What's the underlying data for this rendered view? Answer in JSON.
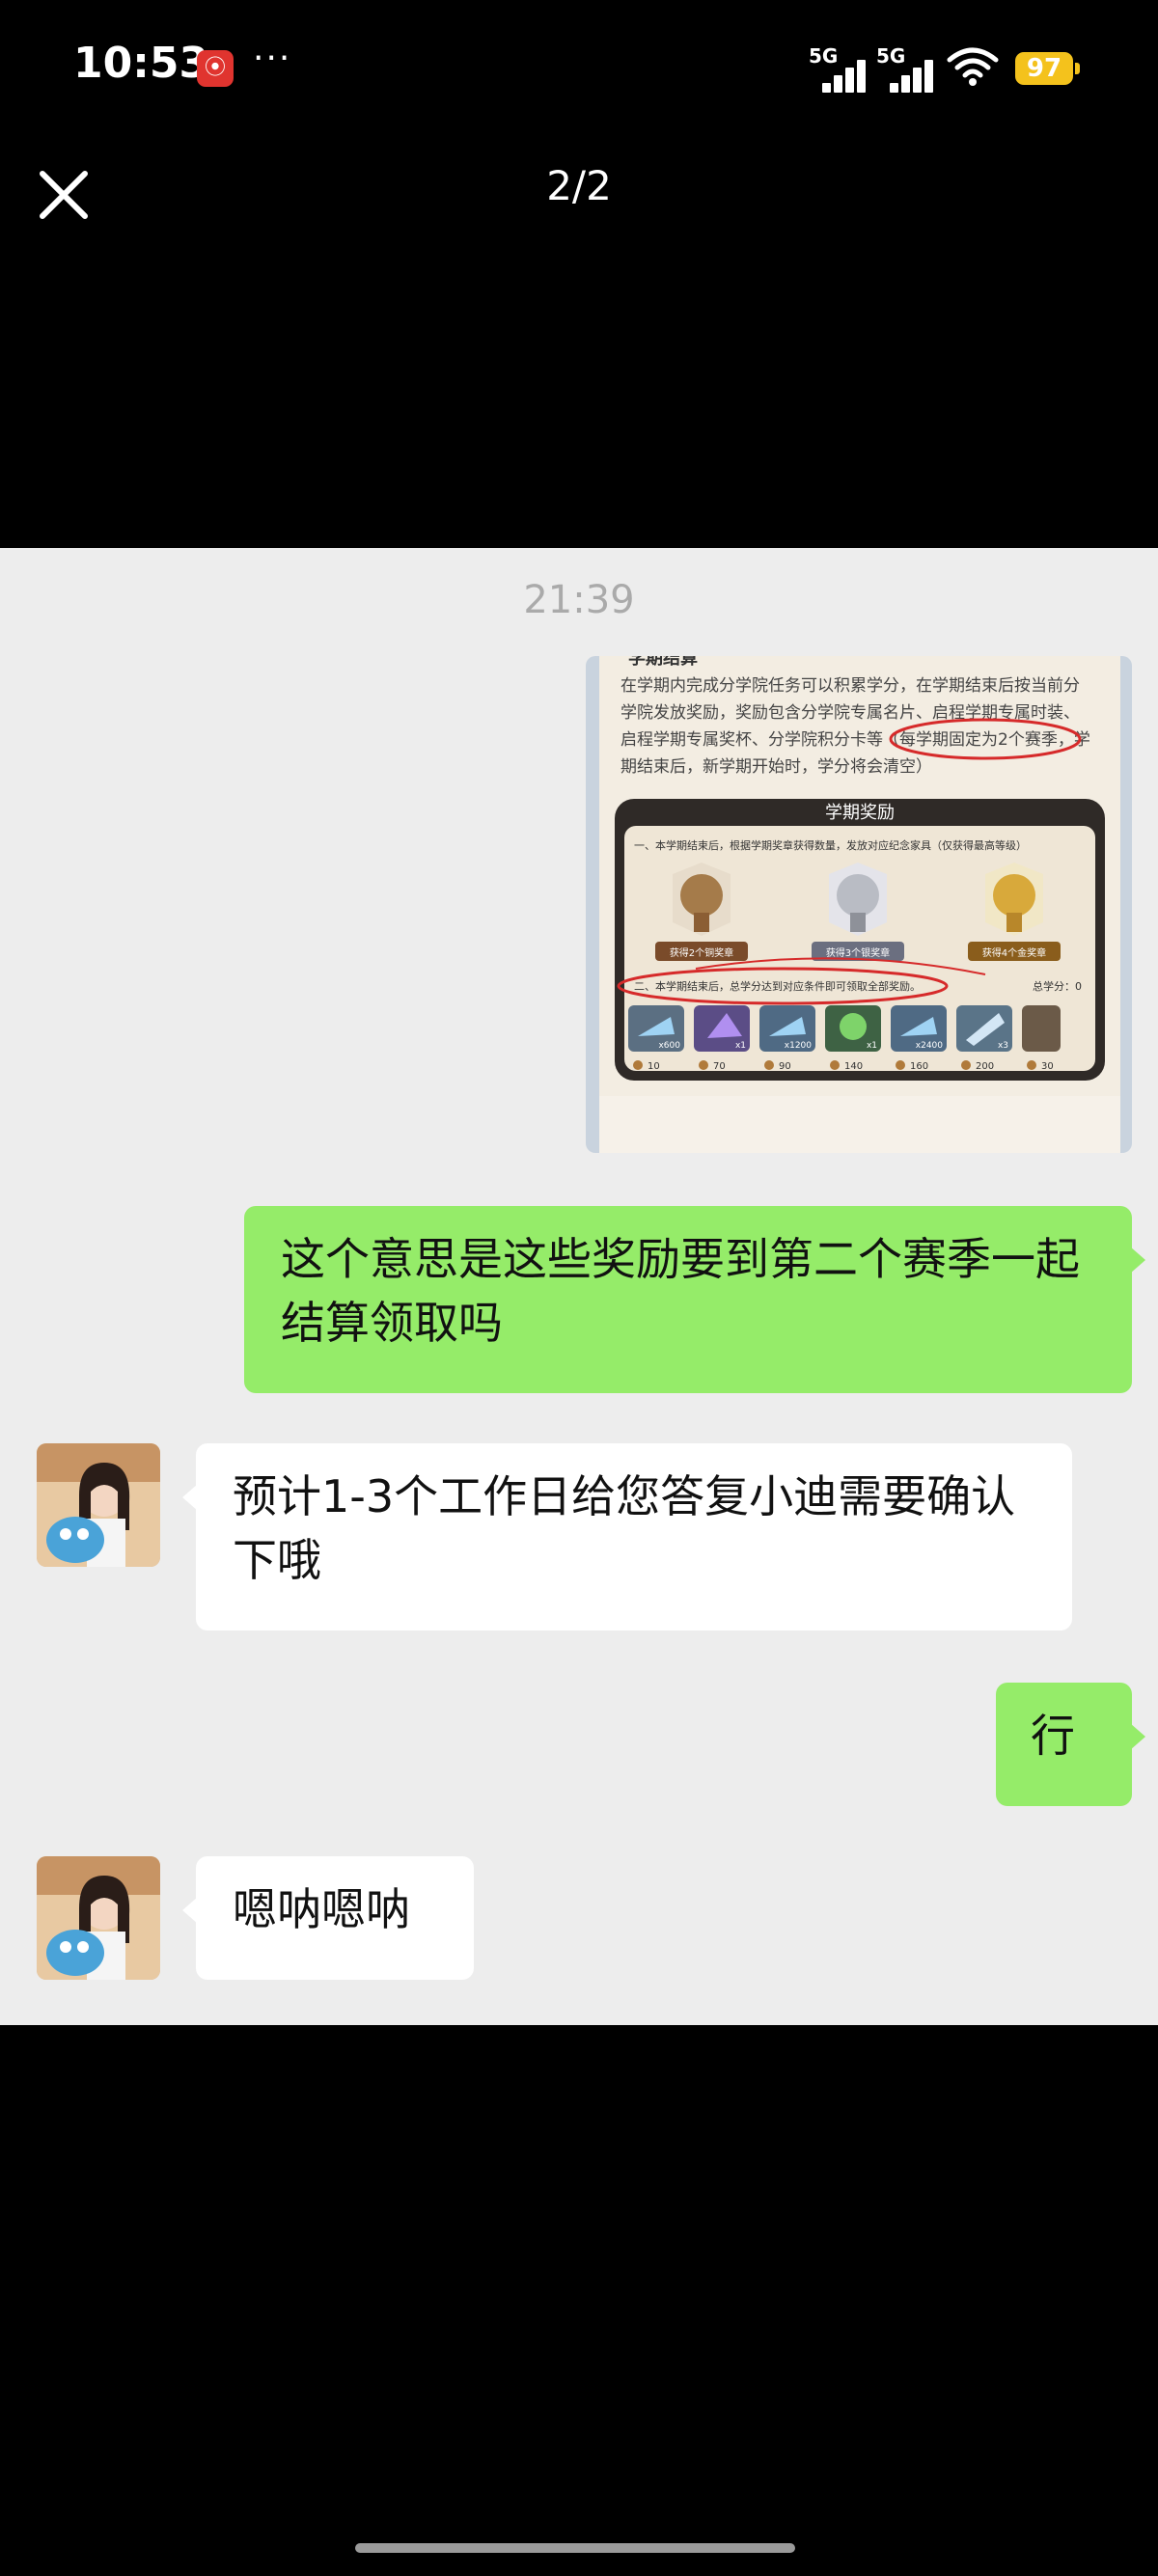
{
  "status_bar": {
    "time": "10:53",
    "notification_badge": "⦿",
    "more": "···",
    "sim1_label": "5G",
    "sim2_label": "5G",
    "battery": "97",
    "battery_color": "#f4c21c"
  },
  "viewer": {
    "page_indicator": "2/2"
  },
  "chat": {
    "timestamp": "21:39",
    "screenshot": {
      "header": "学期结算",
      "body_text": "在学期内完成分学院任务可以积累学分，在学期结束后按当前分学院发放奖励，奖励包含分学院专属名片、启程学期专属时装、启程学期专属奖杯、分学院积分卡等（每学期固定为2个赛季，学期结束后，新学期开始时，学分将会清空）",
      "body_lines": [
        "在学期内完成分学院任务可以积累学分，在学期结束后按当前分",
        "学院发放奖励，奖励包含分学院专属名片、启程学期专属时装、",
        "启程学期专属奖杯、分学院积分卡等（每学期固定为2个赛季，学",
        "期结束后，新学期开始时，学分将会清空）"
      ],
      "highlight": "每学期固定为2个赛季",
      "panel_title": "学期奖励",
      "panel_note1": "一、本学期结束后，根据学期奖章获得数量，发放对应纪念家具（仅获得最高等级）",
      "trophies": [
        "获得2个铜奖章",
        "获得3个银奖章",
        "获得4个金奖章"
      ],
      "panel_note2": "二、本学期结束后，总学分达到对应条件即可领取全部奖励。",
      "total_credits": "总学分：0",
      "reward_counts": [
        "x600",
        "x1",
        "x1200",
        "x1",
        "x2400",
        "x3",
        ""
      ],
      "reward_costs": [
        "10",
        "70",
        "90",
        "140",
        "160",
        "200",
        "30"
      ]
    },
    "messages": [
      {
        "from": "me",
        "text": "这个意思是这些奖励要到第二个赛季一起结算领取吗"
      },
      {
        "from": "agent",
        "text": "预计1-3个工作日给您答复小迪需要确认下哦"
      },
      {
        "from": "me",
        "text": "行"
      },
      {
        "from": "agent",
        "text": "嗯呐嗯呐"
      }
    ],
    "green_bubble_color": "#95ec69"
  }
}
